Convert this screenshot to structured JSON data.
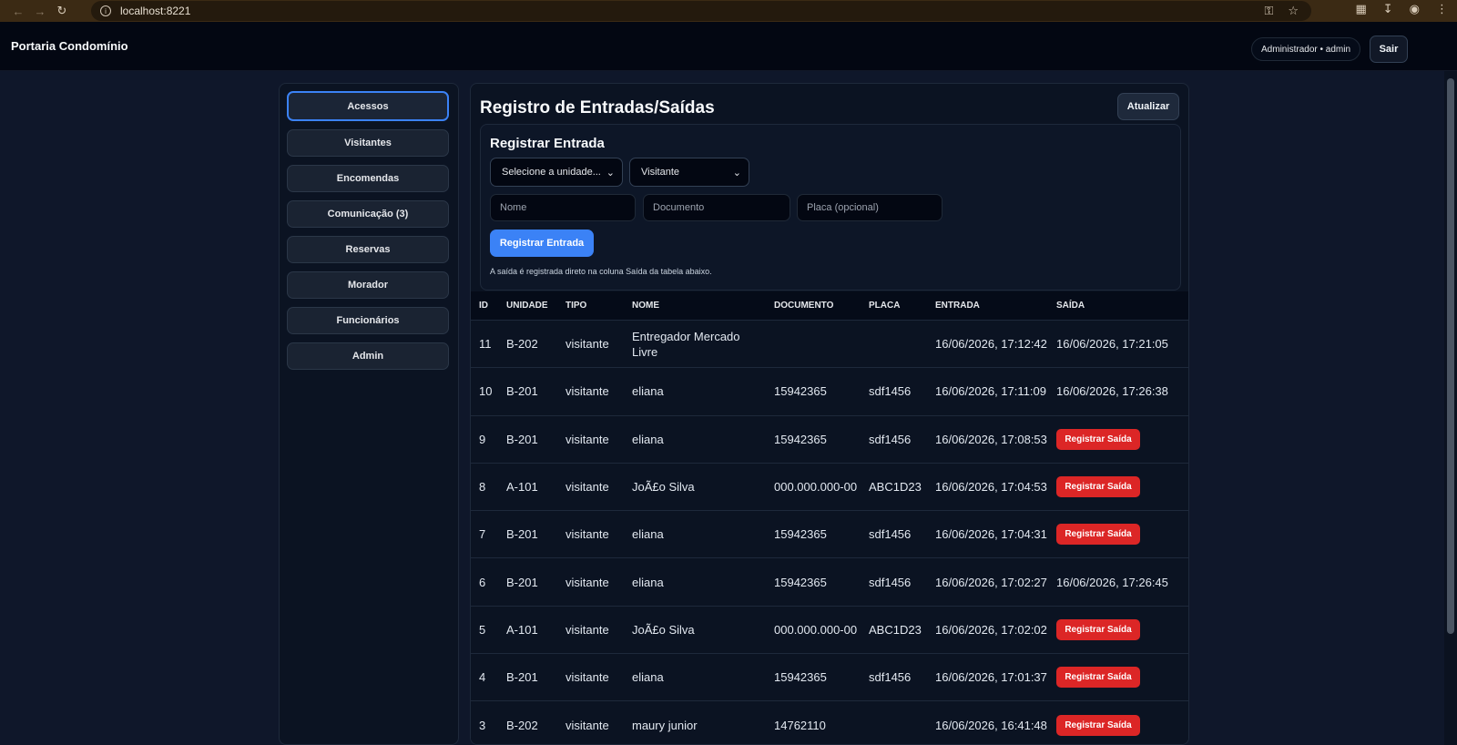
{
  "browser": {
    "url": "localhost:8221"
  },
  "app": {
    "brand": "Portaria Condomínio",
    "user": "Administrador • admin",
    "logout_label": "Sair"
  },
  "sidebar": {
    "items": [
      {
        "label": "Acessos",
        "active": true
      },
      {
        "label": "Visitantes"
      },
      {
        "label": "Encomendas"
      },
      {
        "label": "Comunicação (3)"
      },
      {
        "label": "Reservas"
      },
      {
        "label": "Morador"
      },
      {
        "label": "Funcionários"
      },
      {
        "label": "Admin"
      }
    ]
  },
  "main": {
    "title": "Registro de Entradas/Saídas",
    "refresh_label": "Atualizar",
    "form": {
      "title": "Registrar Entrada",
      "unit_select": "Selecione a unidade...",
      "type_select": "Visitante",
      "name_placeholder": "Nome",
      "doc_placeholder": "Documento",
      "plate_placeholder": "Placa (opcional)",
      "submit_label": "Registrar Entrada",
      "hint": "A saída é registrada direto na coluna Saída da tabela abaixo."
    },
    "table": {
      "headers": [
        "ID",
        "UNIDADE",
        "TIPO",
        "NOME",
        "DOCUMENTO",
        "PLACA",
        "ENTRADA",
        "SAÍDA"
      ],
      "exit_button_label": "Registrar Saída",
      "rows": [
        {
          "id": "11",
          "unit": "B-202",
          "type": "visitante",
          "name": "Entregador Mercado Livre",
          "doc": "",
          "plate": "",
          "entry": "16/06/2026, 17:12:42",
          "exit": "16/06/2026, 17:21:05"
        },
        {
          "id": "10",
          "unit": "B-201",
          "type": "visitante",
          "name": "eliana",
          "doc": "15942365",
          "plate": "sdf1456",
          "entry": "16/06/2026, 17:11:09",
          "exit": "16/06/2026, 17:26:38"
        },
        {
          "id": "9",
          "unit": "B-201",
          "type": "visitante",
          "name": "eliana",
          "doc": "15942365",
          "plate": "sdf1456",
          "entry": "16/06/2026, 17:08:53",
          "exit": ""
        },
        {
          "id": "8",
          "unit": "A-101",
          "type": "visitante",
          "name": "JoÃ£o Silva",
          "doc": "000.000.000-00",
          "plate": "ABC1D23",
          "entry": "16/06/2026, 17:04:53",
          "exit": ""
        },
        {
          "id": "7",
          "unit": "B-201",
          "type": "visitante",
          "name": "eliana",
          "doc": "15942365",
          "plate": "sdf1456",
          "entry": "16/06/2026, 17:04:31",
          "exit": ""
        },
        {
          "id": "6",
          "unit": "B-201",
          "type": "visitante",
          "name": "eliana",
          "doc": "15942365",
          "plate": "sdf1456",
          "entry": "16/06/2026, 17:02:27",
          "exit": "16/06/2026, 17:26:45"
        },
        {
          "id": "5",
          "unit": "A-101",
          "type": "visitante",
          "name": "JoÃ£o Silva",
          "doc": "000.000.000-00",
          "plate": "ABC1D23",
          "entry": "16/06/2026, 17:02:02",
          "exit": ""
        },
        {
          "id": "4",
          "unit": "B-201",
          "type": "visitante",
          "name": "eliana",
          "doc": "15942365",
          "plate": "sdf1456",
          "entry": "16/06/2026, 17:01:37",
          "exit": ""
        },
        {
          "id": "3",
          "unit": "B-202",
          "type": "visitante",
          "name": "maury junior",
          "doc": "14762110",
          "plate": "",
          "entry": "16/06/2026, 16:41:48",
          "exit": ""
        }
      ]
    }
  },
  "colors": {
    "accent": "#3b82f6",
    "danger": "#dc2626",
    "background": "#0f172a"
  },
  "icons": {
    "back": "arrow-left-icon",
    "forward": "arrow-right-icon",
    "reload": "reload-icon",
    "info": "info-icon",
    "key": "key-icon",
    "star": "star-icon",
    "extensions": "puzzle-icon",
    "download": "download-icon",
    "profile": "profile-icon",
    "menu": "kebab-menu-icon",
    "chevron": "chevron-down-icon"
  }
}
